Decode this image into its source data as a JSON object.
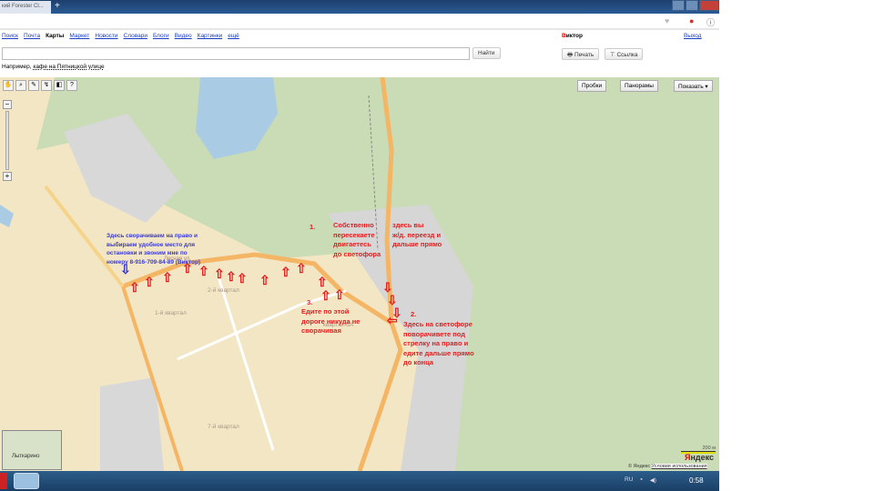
{
  "browser": {
    "tab_title": "кий Forester Cl...",
    "new_tab": "+"
  },
  "nav": {
    "links": [
      "Поиск",
      "Почта"
    ],
    "current": "Карты",
    "links2": [
      "Маркет",
      "Новости",
      "Словари",
      "Блоги",
      "Видео",
      "Картинки",
      "ещё"
    ]
  },
  "user": {
    "first": "В",
    "rest": "иктор",
    "logout": "Выход"
  },
  "search": {
    "value": "",
    "button": "Найти",
    "hint_prefix": "Например,",
    "hint_link": "кафе на Пятницкой улице"
  },
  "actions": {
    "print": "Печать",
    "links": "Ссылка"
  },
  "map_controls": {
    "traffic": "Пробки",
    "panoramas": "Панорамы",
    "show": "Показать ▾"
  },
  "notes": {
    "blue": "Здесь сворачиваем на право и\nвыбираем удобное место для\nостановки и звоним мне по\nномеру 8-916-709-84-89 (Виктор)",
    "n1": "1.",
    "n1a": "Собственно\nпересекаете\nдвигаетесь\nдо светофора",
    "n1b": "здесь вы\nж/д. переезд и\nдальше прямо",
    "n2": "2.",
    "n2a": "Здесь на светофоре\nповорачивете под\nстрелку на право и\nедите дальше прямо\nдо конца",
    "n3": "3.",
    "n3a": "Едите по этой\nдороге никуда не\nсворачивая"
  },
  "map_labels": {
    "kv1": "1-й квартал",
    "kv2": "2-й квартал",
    "kv3a": "квартал 3А",
    "kv7": "7-й квартал",
    "lesnaya": "Лесная ул.",
    "mini": "Лыткарино"
  },
  "footer": {
    "scale": "200 м",
    "logo_first": "Я",
    "logo_rest": "ндекс",
    "copy": "© Яндекс",
    "terms": "Условия использования"
  },
  "taskbar": {
    "lang": "RU",
    "time": "0:58"
  }
}
